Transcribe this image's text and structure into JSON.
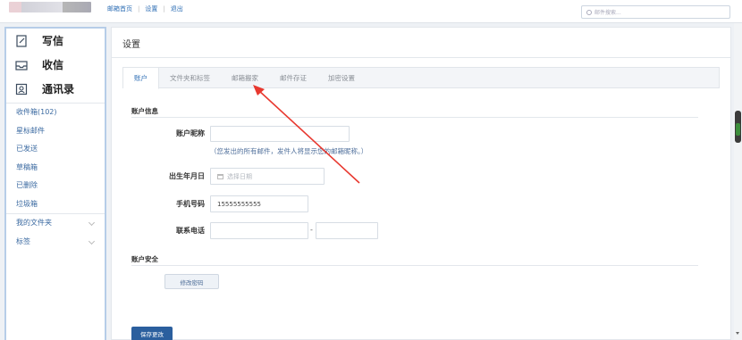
{
  "topbar": {
    "nav": [
      "邮箱首页",
      "设置",
      "退出"
    ],
    "search_placeholder": "邮件搜索..."
  },
  "sidebar": {
    "primary": [
      {
        "label": "写信",
        "icon": "compose-icon"
      },
      {
        "label": "收信",
        "icon": "inbox-icon"
      },
      {
        "label": "通讯录",
        "icon": "contacts-icon"
      }
    ],
    "folders": [
      "收件箱(102)",
      "星标邮件",
      "已发送",
      "草稿箱",
      "已删除",
      "垃圾箱"
    ],
    "groups": [
      "我的文件夹",
      "标签"
    ]
  },
  "main": {
    "title": "设置",
    "tabs": [
      "账户",
      "文件夹和标签",
      "邮箱搬家",
      "邮件存证",
      "加密设置"
    ],
    "active_tab": "账户",
    "account_info": {
      "heading": "账户信息",
      "nickname_label": "账户昵称",
      "nickname_value": "",
      "nickname_hint": "（您发出的所有邮件，发件人将显示您的邮箱昵称。）",
      "birthday_label": "出生年月日",
      "birthday_placeholder": "选择日期",
      "mobile_label": "手机号码",
      "mobile_value": "15555555555",
      "phone_label": "联系电话",
      "phone_separator": "-"
    },
    "account_security": {
      "heading": "账户安全",
      "change_password": "修改密码"
    },
    "save_label": "保存更改"
  },
  "colors": {
    "accent": "#2b5f9e",
    "link": "#2f6fb5",
    "annotation_arrow": "#e8382f"
  }
}
